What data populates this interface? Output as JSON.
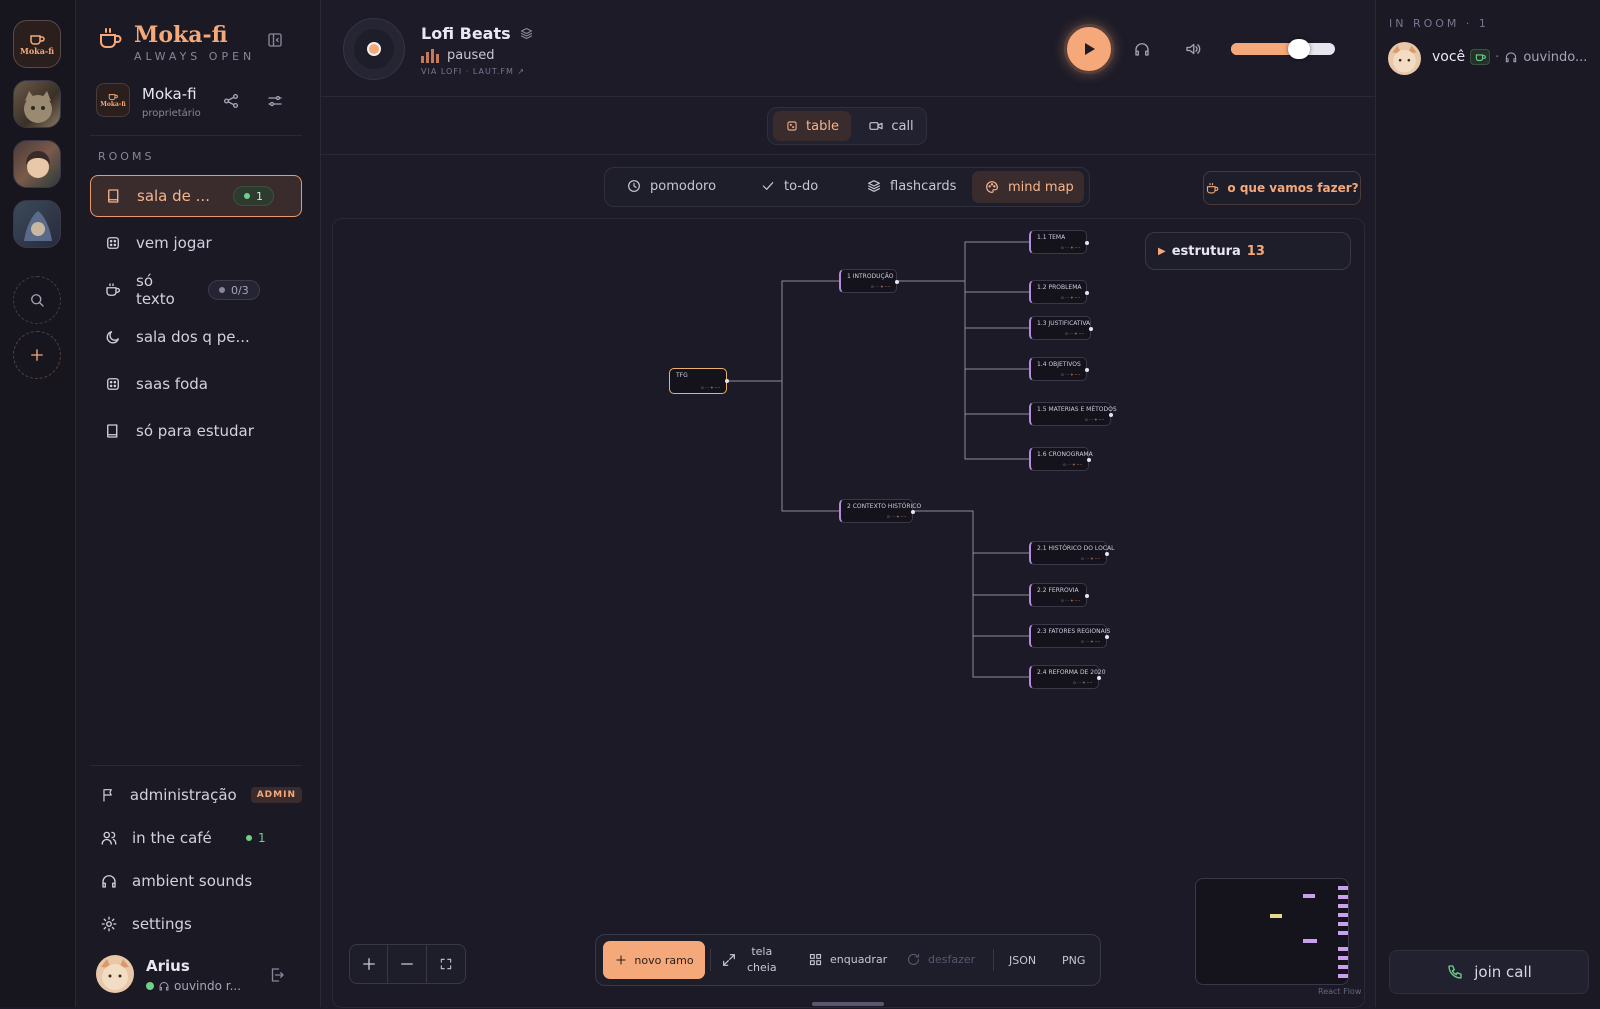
{
  "rail": {
    "logo_text": "Moka-fi"
  },
  "brand": {
    "title": "Moka-fi",
    "subtitle": "ALWAYS OPEN"
  },
  "server": {
    "name": "Moka-fi",
    "role": "proprietário",
    "logo_text": "Moka-fi"
  },
  "rooms": {
    "heading": "ROOMS",
    "items": [
      {
        "label": "sala de ...",
        "icon": "book-icon",
        "badge": "1",
        "badge_dot": true
      },
      {
        "label": "vem jogar",
        "icon": "dice-icon"
      },
      {
        "label": "só texto",
        "icon": "coffee-icon",
        "badge": "0/3",
        "badge_dot": false
      },
      {
        "label": "sala dos q pe...",
        "icon": "moon-icon"
      },
      {
        "label": "saas foda",
        "icon": "dice-icon"
      },
      {
        "label": "só para estudar",
        "icon": "book-icon"
      }
    ]
  },
  "nav": {
    "admin": {
      "label": "administração",
      "badge": "ADMIN"
    },
    "cafe": {
      "label": "in the café",
      "count": "1"
    },
    "ambient": {
      "label": "ambient sounds"
    },
    "settings": {
      "label": "settings"
    }
  },
  "user": {
    "name": "Arius",
    "status": "ouvindo r..."
  },
  "player": {
    "title": "Lofi Beats",
    "status": "paused",
    "source_prefix": "VIA",
    "source": "LOFI · LAUT.FM ↗",
    "volume": 0.65
  },
  "modes": {
    "table": "table",
    "call": "call"
  },
  "tools": {
    "pomodoro": "pomodoro",
    "todo": "to-do",
    "flashcards": "flashcards",
    "mindmap": "mind map",
    "cta": "o que vamos fazer?"
  },
  "mindmap": {
    "panel": {
      "label": "estrutura",
      "count": "13"
    },
    "root": "TFG",
    "branch1": "1 INTRODUÇÃO",
    "branch2": "2 CONTEXTO HISTÓRICO",
    "leaves1": [
      "1.1 TEMA",
      "1.2 PROBLEMA",
      "1.3 JUSTIFICATIVA",
      "1.4 OBJETIVOS",
      "1.5 MATERIAS E MÉTODOS",
      "1.6 CRONOGRAMA"
    ],
    "leaves2": [
      "2.1 HISTÓRICO DO LOCAL",
      "2.2 FERROVIA",
      "2.3 FATORES REGIONAIS",
      "2.4 REFORMA DE 2020"
    ],
    "node_meta_a": "⊙ ···",
    "node_meta_b": "+ ····",
    "attribution": "React Flow"
  },
  "toolbar": {
    "novo": "novo ramo",
    "tela_1": "tela",
    "tela_2": "cheia",
    "enquadrar": "enquadrar",
    "desfazer": "desfazer",
    "json": "JSON",
    "png": "PNG"
  },
  "inroom": {
    "heading": "IN ROOM · 1",
    "name": "você",
    "status": "ouvindo..."
  },
  "call": {
    "label": "join call"
  },
  "colors": {
    "accent": "#f5a97a",
    "green": "#6fd08a",
    "purple": "#b58be0",
    "bg": "#1c1b27"
  }
}
